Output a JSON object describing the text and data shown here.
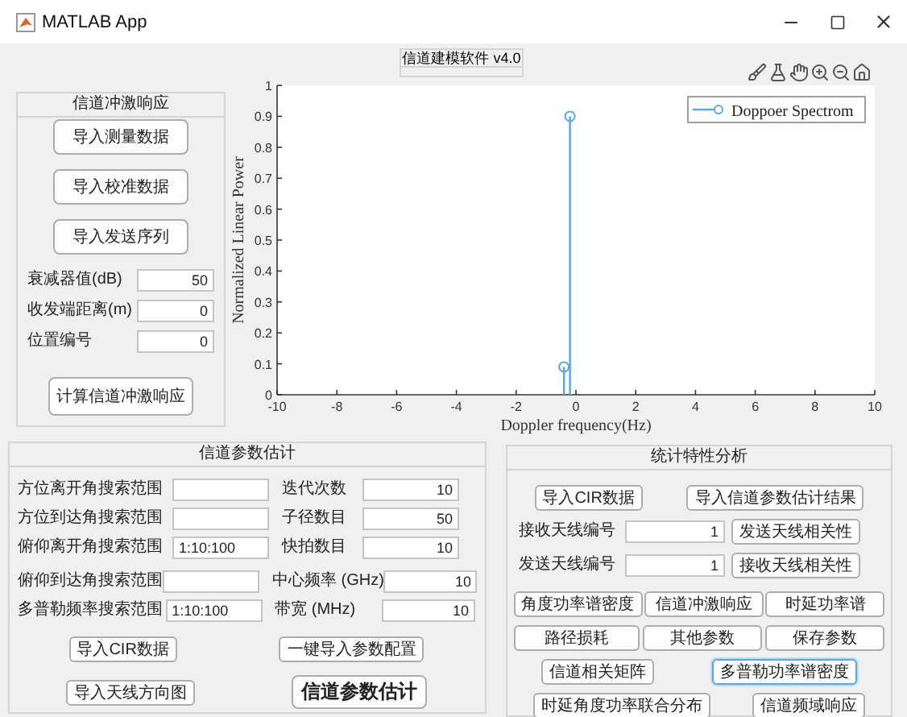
{
  "window": {
    "title": "MATLAB App"
  },
  "version_label": "信道建模软件 v4.0",
  "impulse_panel": {
    "title": "信道冲激响应",
    "buttons": [
      "导入测量数据",
      "导入校准数据",
      "导入发送序列"
    ],
    "fields": [
      {
        "label": "衰减器值(dB)",
        "value": "50"
      },
      {
        "label": "收发端距离(m)",
        "value": "0"
      },
      {
        "label": "位置编号",
        "value": "0"
      }
    ],
    "compute_button": "计算信道冲激响应"
  },
  "chart": {
    "chart_data": {
      "type": "bar",
      "xlabel": "Doppler frequency(Hz)",
      "ylabel": "Normalized Linear Power",
      "x": [
        -0.4,
        -0.2
      ],
      "series": [
        {
          "name": "Doppoer Spectrom",
          "color": "#5aa6e0",
          "values": [
            0.09,
            0.9
          ]
        }
      ],
      "xlim": [
        -10,
        10
      ],
      "ylim": [
        0,
        1
      ],
      "xticks": [
        -10,
        -8,
        -6,
        -4,
        -2,
        0,
        2,
        4,
        6,
        8,
        10
      ],
      "yticks": [
        0,
        0.1,
        0.2,
        0.3,
        0.4,
        0.5,
        0.6,
        0.7,
        0.8,
        0.9,
        1
      ]
    }
  },
  "estimation_panel": {
    "title": "信道参数估计",
    "rows": [
      {
        "left": {
          "label": "方位离开角搜索范围"
        },
        "right": {
          "label": "迭代次数",
          "value": "10",
          "kind": "narrow"
        }
      },
      {
        "left": {
          "label": "方位到达角搜索范围"
        },
        "right": {
          "label": "子径数目",
          "value": "50",
          "kind": "narrow"
        }
      },
      {
        "left": {
          "label": "俯仰离开角搜索范围",
          "value": "1:10:100"
        },
        "right": {
          "label": "快拍数目",
          "value": "10",
          "kind": "narrow"
        }
      },
      {
        "left": {
          "label": "俯仰到达角搜索范围"
        },
        "right": {
          "label": "中心频率 (GHz)",
          "value": "10",
          "kind": "wide"
        }
      },
      {
        "left": {
          "label": "多普勒频率搜索范围",
          "value": "1:10:100"
        },
        "right": {
          "label": "带宽 (MHz)",
          "value": "10",
          "kind": "wide"
        }
      }
    ],
    "buttons": [
      {
        "left": "导入CIR数据",
        "right": {
          "label": "一键导入参数配置",
          "kind": "plain"
        }
      },
      {
        "left": "导入天线方向图",
        "right": {
          "label": "信道参数估计",
          "kind": "primary"
        }
      }
    ]
  },
  "statistics_panel": {
    "title": "统计特性分析",
    "import_buttons": [
      "导入CIR数据",
      "导入信道参数估计结果"
    ],
    "antenna_rows": [
      {
        "label": "接收天线编号",
        "value": "1",
        "button": "发送天线相关性"
      },
      {
        "label": "发送天线编号",
        "value": "1",
        "button": "接收天线相关性"
      }
    ],
    "button_rows": [
      [
        {
          "label": "角度功率谱密度",
          "focused": false
        },
        {
          "label": "信道冲激响应",
          "focused": false
        },
        {
          "label": "时延功率谱",
          "focused": false
        }
      ],
      [
        {
          "label": "路径损耗",
          "focused": false
        },
        {
          "label": "其他参数",
          "focused": false
        },
        {
          "label": "保存参数",
          "focused": false
        }
      ],
      [
        {
          "label": "信道相关矩阵",
          "focused": false
        },
        {
          "label": "多普勒功率谱密度",
          "focused": true
        }
      ],
      [
        {
          "label": "时延角度功率联合分布",
          "focused": false
        },
        {
          "label": "信道频域响应",
          "focused": false
        }
      ]
    ]
  }
}
